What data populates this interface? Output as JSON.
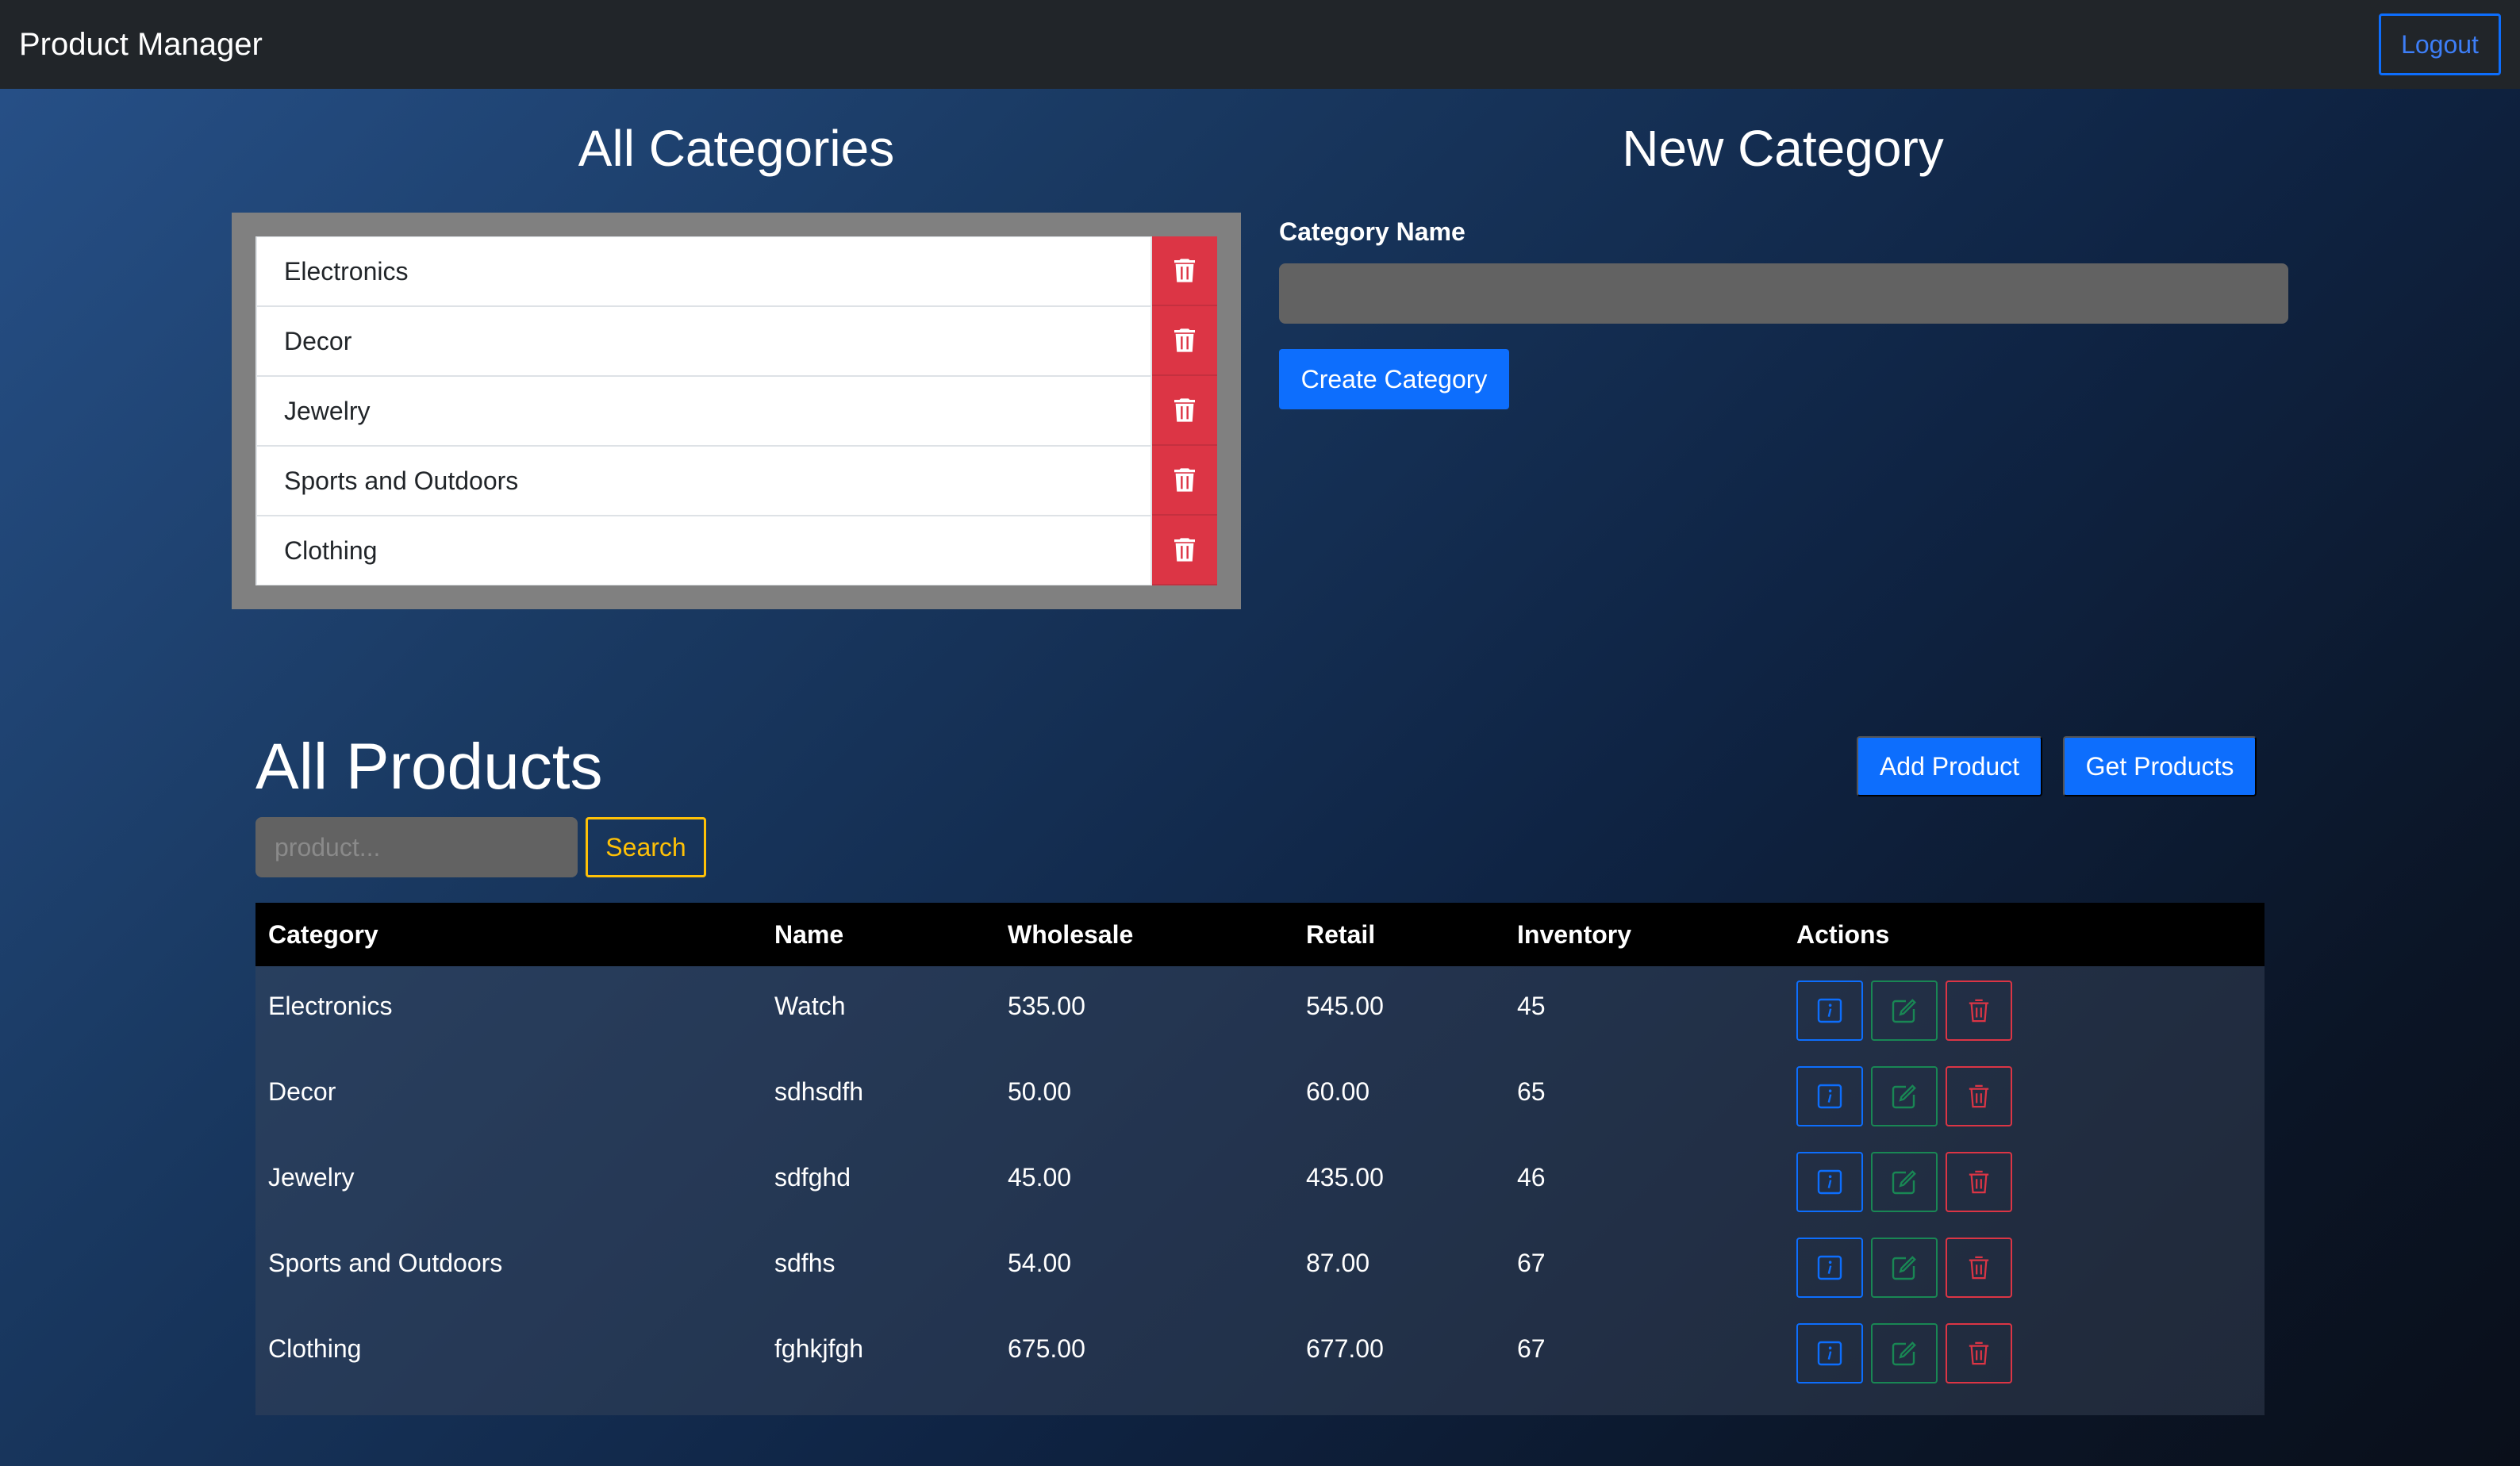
{
  "navbar": {
    "brand": "Product Manager",
    "logout_label": "Logout"
  },
  "categories_section": {
    "title": "All Categories",
    "items": [
      {
        "name": "Electronics"
      },
      {
        "name": "Decor"
      },
      {
        "name": "Jewelry"
      },
      {
        "name": "Sports and Outdoors"
      },
      {
        "name": "Clothing"
      }
    ]
  },
  "new_category": {
    "title": "New Category",
    "label": "Category Name",
    "input_value": "",
    "button_label": "Create Category"
  },
  "products_section": {
    "title": "All Products",
    "add_label": "Add Product",
    "get_label": "Get Products",
    "search_placeholder": "product...",
    "search_label": "Search",
    "columns": [
      "Category",
      "Name",
      "Wholesale",
      "Retail",
      "Inventory",
      "Actions"
    ],
    "rows": [
      {
        "category": "Electronics",
        "name": "Watch",
        "wholesale": "535.00",
        "retail": "545.00",
        "inventory": "45"
      },
      {
        "category": "Decor",
        "name": "sdhsdfh",
        "wholesale": "50.00",
        "retail": "60.00",
        "inventory": "65"
      },
      {
        "category": "Jewelry",
        "name": "sdfghd",
        "wholesale": "45.00",
        "retail": "435.00",
        "inventory": "46"
      },
      {
        "category": "Sports and Outdoors",
        "name": "sdfhs",
        "wholesale": "54.00",
        "retail": "87.00",
        "inventory": "67"
      },
      {
        "category": "Clothing",
        "name": "fghkjfgh",
        "wholesale": "675.00",
        "retail": "677.00",
        "inventory": "67"
      }
    ]
  },
  "colors": {
    "primary": "#0d6efd",
    "danger": "#dc3545",
    "success": "#198754",
    "warning": "#ffc107",
    "navbar": "#212529"
  },
  "icons": {
    "category_delete": "trash-icon",
    "row_info": "info-icon",
    "row_edit": "edit-icon",
    "row_delete": "trash-icon"
  }
}
